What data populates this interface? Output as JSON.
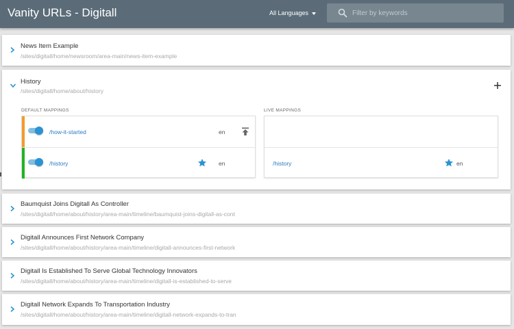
{
  "header": {
    "title": "Vanity URLs - Digitall",
    "language_selector": "All Languages",
    "search_placeholder": "Filter by keywords",
    "colors": {
      "bar": "#5b6c78",
      "search_bg": "#77868f"
    }
  },
  "pages": [
    {
      "name": "News Item Example",
      "path": "/sites/digitall/home/newsroom/area-main/news-item-example",
      "expanded": false
    },
    {
      "name": "History",
      "path": "/sites/digitall/home/about/history",
      "expanded": true,
      "default_mappings_label": "DEFAULT MAPPINGS",
      "live_mappings_label": "LIVE MAPPINGS",
      "default_mappings": [
        {
          "url": "/how-it-started",
          "lang": "en",
          "enabled": true,
          "default": false,
          "stripe_color": "#f39b2b",
          "action_icon": "publish-icon"
        },
        {
          "url": "/history",
          "lang": "en",
          "enabled": true,
          "default": true,
          "stripe_color": "#22b322",
          "action_icon": "star-icon"
        }
      ],
      "live_mappings": [
        {
          "url": "",
          "lang": ""
        },
        {
          "url": "/history",
          "lang": "en",
          "default": true
        }
      ]
    },
    {
      "name": "Baumquist Joins Digitall As Controller",
      "path": "/sites/digitall/home/about/history/area-main/timeline/baumquist-joins-digitall-as-cont",
      "expanded": false
    },
    {
      "name": "Digitall Announces First Network Company",
      "path": "/sites/digitall/home/about/history/area-main/timeline/digitall-announces-first-network",
      "expanded": false
    },
    {
      "name": "Digitall Is Established To Serve Global Technology Innovators",
      "path": "/sites/digitall/home/about/history/area-main/timeline/digitall-is-established-to-serve",
      "expanded": false
    },
    {
      "name": "Digitall Network Expands To Transportation Industry",
      "path": "/sites/digitall/home/about/history/area-main/timeline/digitall-network-expands-to-tran",
      "expanded": false
    }
  ],
  "accent_color": "#2b93d3"
}
